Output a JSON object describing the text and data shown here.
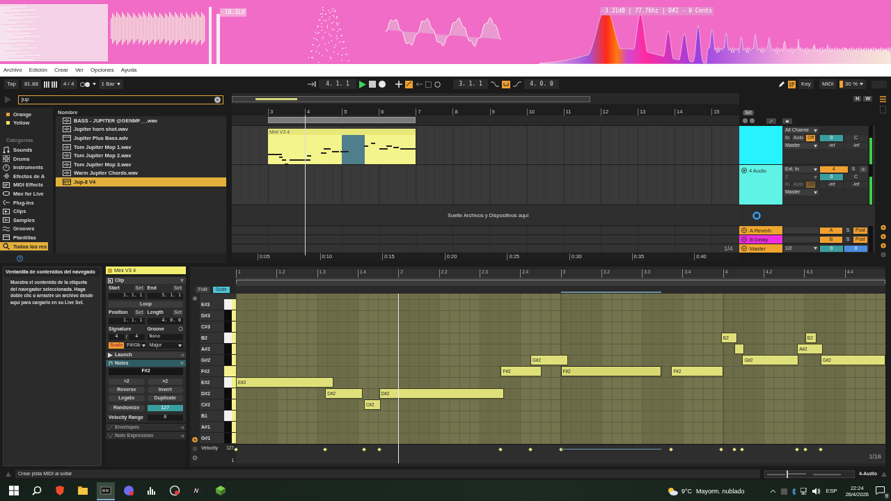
{
  "visualizer": {
    "loudness": "-10.1LU",
    "pitch_readout": "-3.31dB | 77.76hz | D#2 - 0 Cents"
  },
  "menu": [
    "Archivo",
    "Edición",
    "Crear",
    "Ver",
    "Opciones",
    "Ayuda"
  ],
  "transport": {
    "tap": "Tap",
    "tempo": "81.88",
    "signature": "4 / 4",
    "quantize": "1 Bar",
    "arrangement_position": "4. 1. 1",
    "playing": true,
    "loop_start": "3. 1. 1",
    "loop_on": true,
    "loop_length": "4. 0. 0",
    "key_map": "Key",
    "midi_map": "MIDI",
    "cpu_load": "30 %"
  },
  "browser": {
    "search": "jup",
    "colors": [
      {
        "label": "Orange",
        "color": "#e8a33a"
      },
      {
        "label": "Yellow",
        "color": "#f2e65a"
      }
    ],
    "categories_heading": "Categorías",
    "categories": [
      {
        "kind": "sounds",
        "label": "Sounds",
        "selected": false
      },
      {
        "kind": "drums",
        "label": "Drums",
        "selected": false
      },
      {
        "kind": "instruments",
        "label": "Instruments",
        "selected": false
      },
      {
        "kind": "audio_effects",
        "label": "Efectos de A",
        "selected": false
      },
      {
        "kind": "midi_effects",
        "label": "MIDI Effects",
        "selected": false
      },
      {
        "kind": "max",
        "label": "Max for Live",
        "selected": false
      },
      {
        "kind": "plugins",
        "label": "Plug-Ins",
        "selected": false
      },
      {
        "kind": "clips",
        "label": "Clips",
        "selected": false
      },
      {
        "kind": "samples",
        "label": "Samples",
        "selected": false
      },
      {
        "kind": "grooves",
        "label": "Grooves",
        "selected": false
      },
      {
        "kind": "templates",
        "label": "Plantillas",
        "selected": false
      },
      {
        "kind": "all",
        "label": "Todos los res",
        "selected": true
      }
    ],
    "column_heading": "Nombre",
    "files": [
      {
        "kind": "audio",
        "name": "BASS - JUPITER @GENMF__.wav",
        "selected": false
      },
      {
        "kind": "audio",
        "name": "Jupiter horn shot.wav",
        "selected": false
      },
      {
        "kind": "preset",
        "name": "Jupiter Plus Bass.adv",
        "selected": false
      },
      {
        "kind": "audio",
        "name": "Tom Jupiter Mop 1.wav",
        "selected": false
      },
      {
        "kind": "audio",
        "name": "Tom Jupiter Mop 2.wav",
        "selected": false
      },
      {
        "kind": "audio",
        "name": "Tom Jupiter Mop 3.wav",
        "selected": false
      },
      {
        "kind": "audio",
        "name": "Warm Jupiter Chords.wav",
        "selected": false
      },
      {
        "kind": "device",
        "name": "Jup-8 V4",
        "selected": true
      }
    ]
  },
  "arrangement": {
    "overview_buttons": [
      "H",
      "W"
    ],
    "set_label": "Set",
    "bars": [
      "3",
      "4",
      "5",
      "6",
      "7",
      "8",
      "9",
      "10",
      "11",
      "12",
      "13",
      "14",
      "15"
    ],
    "times": [
      "0:05",
      "0:10",
      "0:15",
      "0:20",
      "0:25",
      "0:30",
      "0:35",
      "0:40"
    ],
    "clip": {
      "name": "Mini V3 4"
    },
    "drop_hint": "Suelte Archivos y Dispositivos aquí",
    "grid": "1/4",
    "tracks": [
      {
        "color": "#27f3ff",
        "input": "All Channe",
        "monitor": [
          {
            "label": "In",
            "selected": false
          },
          {
            "label": "Auto",
            "selected": false
          },
          {
            "label": "Off",
            "selected": true
          }
        ],
        "monitor_disabled": false,
        "output": "Master",
        "volume": "0",
        "pan": "C",
        "peaks": [
          "-inf",
          "-inf"
        ]
      },
      {
        "name": "4 Audio",
        "color": "#5ef3e4",
        "input": "Ext. In",
        "channel": "2",
        "monitor": [
          {
            "label": "In",
            "selected": false
          },
          {
            "label": "Auto",
            "selected": false
          },
          {
            "label": "Off",
            "selected": true
          }
        ],
        "monitor_disabled": true,
        "output": "Master",
        "number": "4",
        "solo": "S",
        "volume": "0",
        "pan": "C",
        "peaks": [
          "-inf",
          "-inf"
        ]
      }
    ],
    "returns": [
      {
        "name": "A Reverb",
        "color": "#f0a52e",
        "send": "A",
        "solo": "S",
        "mode": "Post"
      },
      {
        "name": "B Delay",
        "color": "#ee2ee0",
        "send": "B",
        "solo": "S",
        "mode": "Post"
      }
    ],
    "master": {
      "name": "Master",
      "color": "#f0a52e",
      "cue": "1/2",
      "volume": "0",
      "pan": "0"
    }
  },
  "info": {
    "title": "Ventanilla de contenidos del navegado",
    "body": "Muestra el contenido de la etiqueta del navegador seleccionada. Haga doble clic o arrastre un archivo desde aquí para cargarlo en su Live Set."
  },
  "clip_view": {
    "name": "Mini V3 4",
    "sections": [
      {
        "kind": "clip",
        "label": "Clip",
        "expanded": true,
        "disabled": false
      },
      {
        "kind": "launch",
        "label": "Launch",
        "expanded": false,
        "disabled": false
      },
      {
        "kind": "notes",
        "label": "Notes",
        "expanded": true,
        "disabled": false
      },
      {
        "kind": "envelopes",
        "label": "Envelopes",
        "expanded": false,
        "disabled": true
      },
      {
        "kind": "expression",
        "label": "Note Expression",
        "expanded": false,
        "disabled": true
      }
    ],
    "start_label": "Start",
    "end_label": "End",
    "set_buttons": [
      "Set",
      "Set",
      "Set",
      "Set"
    ],
    "start": "1. 1. 1",
    "end": "5. 1. 1",
    "loop": {
      "label": "Loop",
      "on": false
    },
    "position_label": "Position",
    "length_label": "Length",
    "position": "1. 1. 1",
    "length": "4. 0. 0",
    "signature_label": "Signature",
    "groove_label": "Groove",
    "signature": {
      "numerator": "4",
      "separator": "/",
      "denominator": "4"
    },
    "groove": "None",
    "scale": {
      "label": "Scale",
      "on": true,
      "root": "F#/Gb",
      "mode": "Major"
    },
    "pitch": "F#2",
    "note_buttons": [
      "÷2",
      "×2",
      "Reverse",
      "Invert",
      "Legato",
      "Duplicate",
      "Randomize"
    ],
    "randomize_amount": "127",
    "velocity_range_label": "Velocity Range",
    "velocity_range": "0"
  },
  "piano_roll": {
    "fold": {
      "label": "Fold",
      "on": false
    },
    "scale": {
      "label": "Scale",
      "on": true
    },
    "ruler": [
      "1",
      "1.2",
      "1.3",
      "1.4",
      "2",
      "2.2",
      "2.3",
      "2.4",
      "3",
      "3.2",
      "3.3",
      "3.4",
      "4",
      "4.2",
      "4.3",
      "4.4"
    ],
    "keys": [
      {
        "label": "E#3",
        "black": false,
        "selected": false
      },
      {
        "label": "D#3",
        "black": true,
        "selected": false
      },
      {
        "label": "C#3",
        "black": true,
        "selected": false
      },
      {
        "label": "B2",
        "black": false,
        "selected": false,
        "notes": [
          {
            "label": "B2",
            "selected": false
          },
          {
            "label": "B2",
            "selected": false
          }
        ]
      },
      {
        "label": "A#2",
        "black": true,
        "selected": false,
        "notes": [
          {
            "selected": false
          },
          {
            "label": "A#2",
            "selected": false
          }
        ]
      },
      {
        "label": "G#2",
        "black": true,
        "selected": false,
        "notes": [
          {
            "label": "G#2",
            "selected": false
          },
          {
            "label": "G#2",
            "selected": false
          },
          {
            "label": "G#2",
            "selected": false
          }
        ]
      },
      {
        "label": "F#2",
        "black": false,
        "selected": true,
        "notes": [
          {
            "label": "F#2",
            "selected": false
          },
          {
            "label": "F#2",
            "selected": true
          },
          {
            "label": "F#2",
            "selected": false
          }
        ]
      },
      {
        "label": "E#2",
        "black": false,
        "selected": false,
        "notes": [
          {
            "label": "E#2",
            "selected": false
          }
        ]
      },
      {
        "label": "D#2",
        "black": true,
        "selected": false,
        "notes": [
          {
            "label": "D#2",
            "selected": false
          },
          {
            "label": "D#2",
            "selected": false
          }
        ]
      },
      {
        "label": "C#2",
        "black": true,
        "selected": false,
        "notes": [
          {
            "label": "C#2",
            "selected": false
          }
        ]
      },
      {
        "label": "B1",
        "black": false,
        "selected": false
      },
      {
        "label": "A#1",
        "black": true,
        "selected": false
      },
      {
        "label": "G#1",
        "black": true,
        "selected": false
      }
    ],
    "velocity_label": "Velocity",
    "velocity_max": "127",
    "velocity_min": "1",
    "grid": "1/16"
  },
  "status": {
    "hint": "Crear pista MIDI al soltar",
    "track": "4-Audio"
  },
  "taskbar": {
    "apps": [
      {
        "kind": "browser",
        "selected": false
      },
      {
        "kind": "files",
        "selected": false
      },
      {
        "kind": "live",
        "selected": true
      },
      {
        "kind": "chat",
        "selected": false
      },
      {
        "kind": "bars",
        "selected": false
      },
      {
        "kind": "recorder",
        "selected": false
      },
      {
        "kind": "editor",
        "selected": false
      },
      {
        "kind": "cube",
        "selected": false
      }
    ],
    "temperature": "9°C",
    "weather": "Mayorm. nublado",
    "language": "ESP",
    "time": "22:24",
    "date": "26/4/2026",
    "notifications": "9"
  }
}
